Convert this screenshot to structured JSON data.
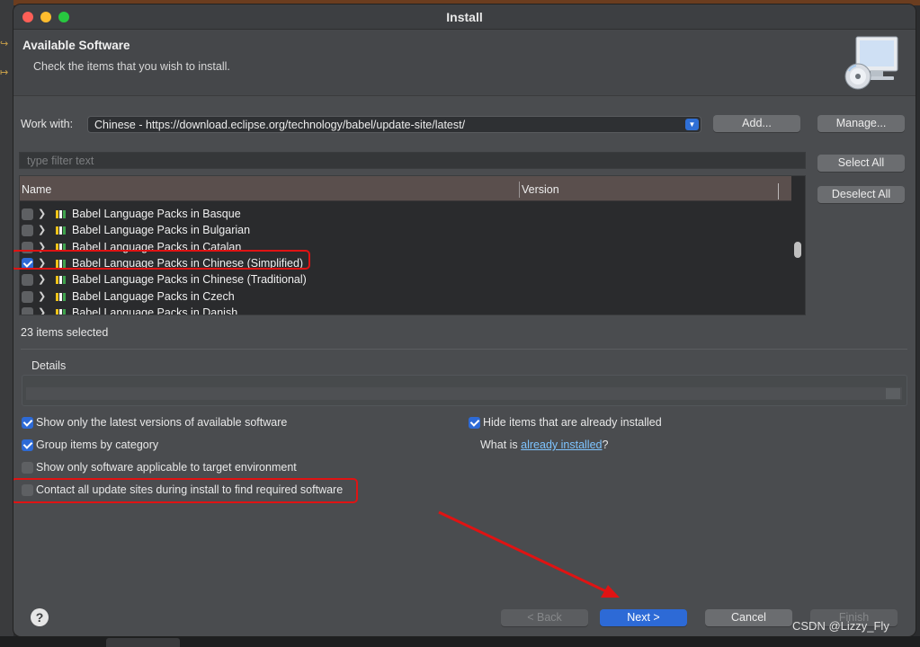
{
  "window": {
    "title": "Install"
  },
  "header": {
    "title": "Available Software",
    "description": "Check the items that you wish to install.",
    "icon": "software-cd-monitor-icon"
  },
  "work_with": {
    "label": "Work with:",
    "value": "Chinese - https://download.eclipse.org/technology/babel/update-site/latest/",
    "add_label": "Add...",
    "manage_label": "Manage..."
  },
  "filter": {
    "placeholder": "type filter text"
  },
  "side_buttons": {
    "select_all": "Select All",
    "deselect_all": "Deselect All"
  },
  "table": {
    "columns": [
      "Name",
      "Version"
    ],
    "rows": [
      {
        "label": "Babel Language Packs in Basque",
        "checked": false
      },
      {
        "label": "Babel Language Packs in Bulgarian",
        "checked": false
      },
      {
        "label": "Babel Language Packs in Catalan",
        "checked": false
      },
      {
        "label": "Babel Language Packs in Chinese (Simplified)",
        "checked": true
      },
      {
        "label": "Babel Language Packs in Chinese (Traditional)",
        "checked": false
      },
      {
        "label": "Babel Language Packs in Czech",
        "checked": false
      },
      {
        "label": "Babel Language Packs in Danish",
        "checked": false
      }
    ]
  },
  "status": "23 items selected",
  "details": {
    "label": "Details"
  },
  "options": {
    "latest_versions": {
      "label": "Show only the latest versions of available software",
      "checked": true
    },
    "group_by_category": {
      "label": "Group items by category",
      "checked": true
    },
    "target_env": {
      "label": "Show only software applicable to target environment",
      "checked": false
    },
    "contact_sites": {
      "label": "Contact all update sites during install to find required software",
      "checked": false
    },
    "hide_installed": {
      "label": "Hide items that are already installed",
      "checked": true
    },
    "what_is_prefix": "What is ",
    "what_is_link": "already installed",
    "what_is_suffix": "?"
  },
  "footer": {
    "help": "?",
    "back": "< Back",
    "next": "Next >",
    "cancel": "Cancel",
    "finish": "Finish"
  },
  "watermark": "CSDN @Lizzy_Fly",
  "colors": {
    "accent": "#2d6ad6",
    "highlight": "#e01313",
    "link": "#7ec4ff"
  }
}
